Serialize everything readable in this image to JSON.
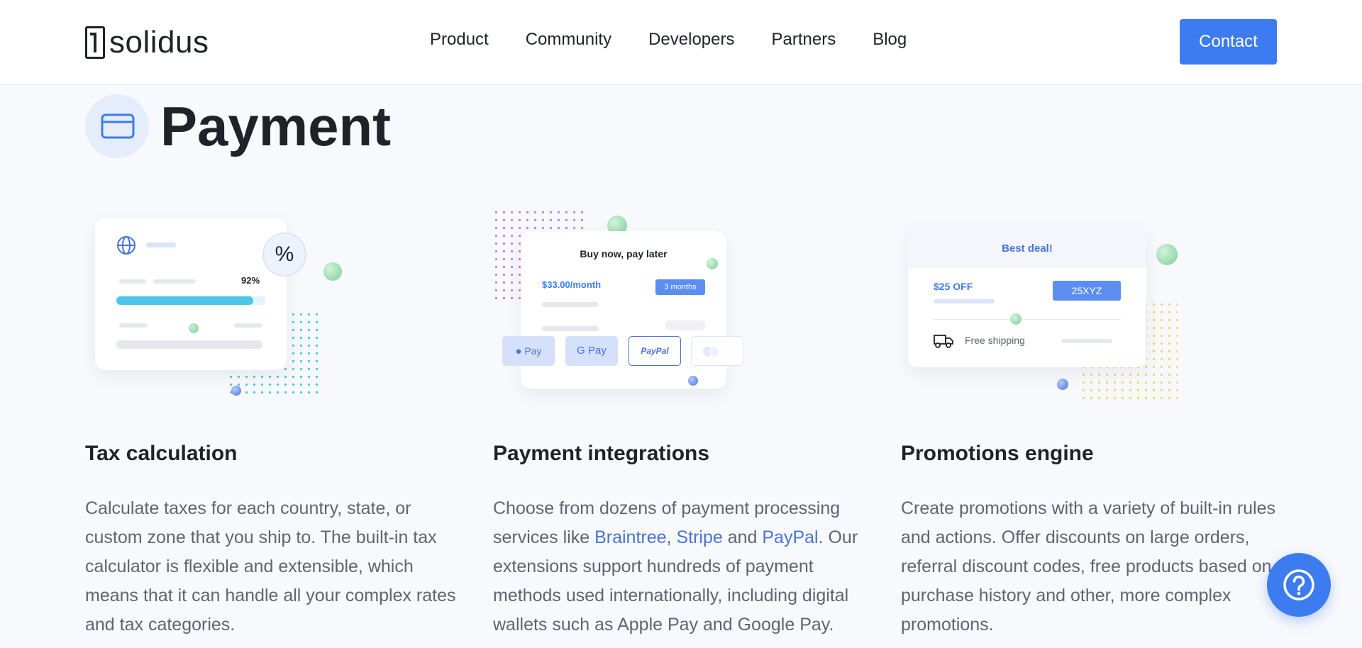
{
  "brand": {
    "name": "solidus"
  },
  "nav": {
    "items": [
      {
        "label": "Product"
      },
      {
        "label": "Community"
      },
      {
        "label": "Developers"
      },
      {
        "label": "Partners"
      },
      {
        "label": "Blog"
      }
    ],
    "contact_label": "Contact"
  },
  "section": {
    "title": "Payment",
    "icon": "credit-card-icon"
  },
  "illustrations": {
    "tax": {
      "percent": "92%"
    },
    "payments": {
      "heading": "Buy now, pay later",
      "price": "$33.00/month",
      "term": "3 months",
      "methods": [
        "Pay",
        "G Pay",
        "PayPal"
      ]
    },
    "promo": {
      "heading": "Best deal!",
      "discount": "$25 OFF",
      "code": "25XYZ",
      "shipping": "Free shipping"
    }
  },
  "features": [
    {
      "title": "Tax calculation",
      "text": "Calculate taxes for each country, state, or custom zone that you ship to. The built-in tax calculator is flexible and extensible, which means that it can handle all your complex rates and tax categories."
    },
    {
      "title": "Payment integrations",
      "text_before": "Choose from dozens of payment processing services like ",
      "links": [
        "Braintree",
        "Stripe",
        "PayPal"
      ],
      "sep1": ", ",
      "sep2": " and ",
      "text_after": ". Our extensions support hundreds of payment methods used internationally, including digital wallets such as Apple Pay and Google Pay."
    },
    {
      "title": "Promotions engine",
      "text": "Create promotions with a variety of built-in rules and actions. Offer discounts on large orders, referral discount codes, free products based on purchase history and other, more complex promotions."
    }
  ],
  "colors": {
    "accent": "#3d7bf0",
    "link": "#4a73d8",
    "progress": "#4bc6e8",
    "tax_progress_fraction": 0.92
  },
  "help": {
    "icon": "question-mark-icon"
  }
}
